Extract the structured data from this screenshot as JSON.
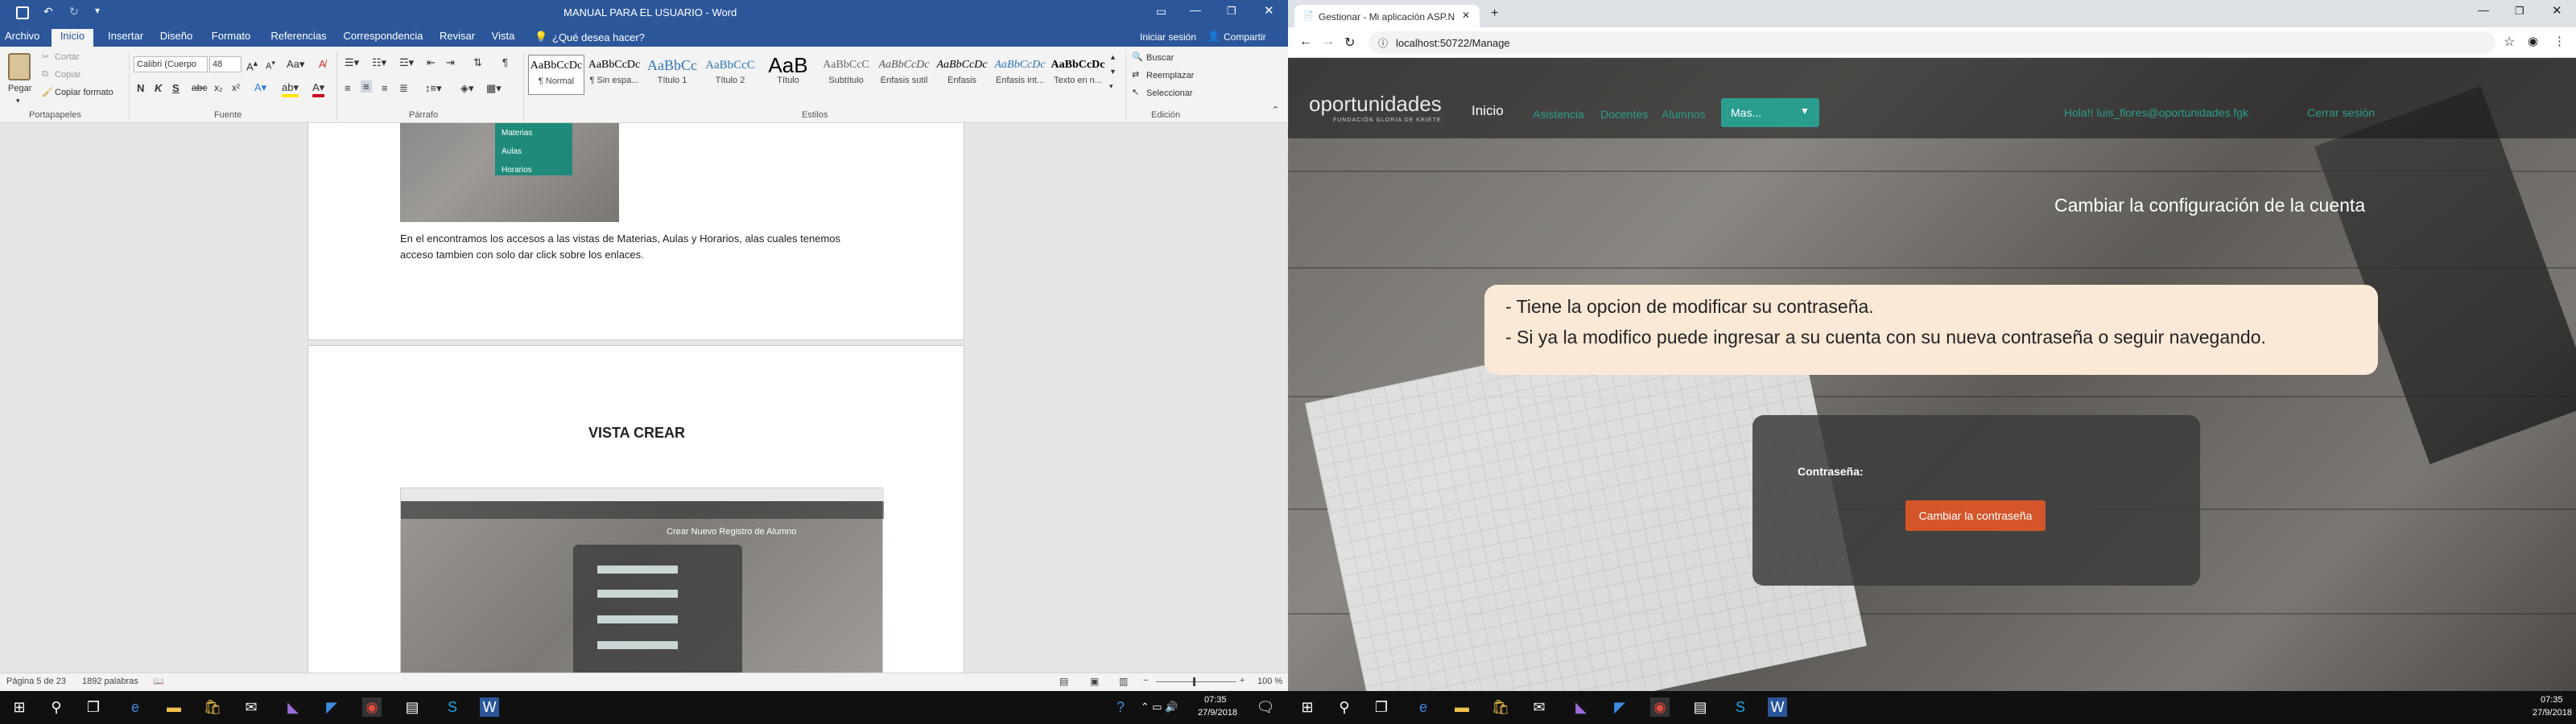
{
  "word": {
    "title": "MANUAL PARA EL USUARIO - Word",
    "quick_access": [
      "save-icon",
      "undo-icon",
      "redo-icon",
      "customize-icon"
    ],
    "ribbon_tabs": [
      "Archivo",
      "Inicio",
      "Insertar",
      "Diseño",
      "Formato",
      "Referencias",
      "Correspondencia",
      "Revisar",
      "Vista"
    ],
    "tell_me": "¿Qué desea hacer?",
    "sign_in": "Iniciar sesión",
    "share": "Compartir",
    "clipboard": {
      "paste": "Pegar",
      "cut": "Cortar",
      "copy": "Copiar",
      "format_painter": "Copiar formato",
      "group": "Portapapeles"
    },
    "font": {
      "name": "Calibri (Cuerpo",
      "size": "48",
      "group": "Fuente",
      "bold": "N",
      "italic": "K",
      "underline": "S"
    },
    "paragraph": {
      "group": "Párrafo"
    },
    "styles": {
      "group": "Estilos",
      "items": [
        {
          "sample": "AaBbCcDc",
          "name": "¶ Normal"
        },
        {
          "sample": "AaBbCcDc",
          "name": "¶ Sin espa..."
        },
        {
          "sample": "AaBbCc",
          "name": "Título 1"
        },
        {
          "sample": "AaBbCcC",
          "name": "Título 2"
        },
        {
          "sample": "AaB",
          "name": "Título"
        },
        {
          "sample": "AaBbCcC",
          "name": "Subtítulo"
        },
        {
          "sample": "AaBbCcDc",
          "name": "Énfasis sutil"
        },
        {
          "sample": "AaBbCcDc",
          "name": "Énfasis"
        },
        {
          "sample": "AaBbCcDc",
          "name": "Énfasis int..."
        },
        {
          "sample": "AaBbCcDc",
          "name": "Texto en n..."
        }
      ]
    },
    "editing": {
      "find": "Buscar",
      "replace": "Reemplazar",
      "select": "Seleccionar",
      "group": "Edición"
    },
    "doc": {
      "menu_items": [
        "Materias",
        "Aulas",
        "Horarios"
      ],
      "paragraph_line1": "En el encontramos los accesos a las vistas de Materias, Aulas y Horarios, alas cuales tenemos",
      "paragraph_line2": "acceso tambien con solo dar click sobre los enlaces.",
      "heading": "VISTA CREAR",
      "thumb_title": "Crear Nuevo Registro de Alumno"
    },
    "status": {
      "page": "Página 5 de 23",
      "words": "1892 palabras",
      "zoom": "100 %"
    }
  },
  "chrome": {
    "tab_title": "Gestionar - Mi aplicación ASP.NE",
    "url": "localhost:50722/Manage",
    "site": {
      "logo": "oportunidades",
      "logo_sub": "FUNDACIÓN GLORIA DE KRIETE",
      "nav": [
        "Inicio",
        "Asistencia",
        "Docentes",
        "Alumnos"
      ],
      "more": "Mas...",
      "greeting": "Hola!! luis_flores@oportunidades.fgk",
      "logout": "Cerrar sesión",
      "heading": "Cambiar la configuración de la cuenta",
      "note_line1": "- Tiene la opcion de modificar su contraseña.",
      "note_line2": "- Si ya la modifico puede ingresar a su cuenta con su nueva contraseña o seguir navegando.",
      "password_label": "Contraseña:",
      "change_button": "Cambiar la contraseña"
    }
  },
  "taskbar": {
    "left_time": "07:35",
    "left_date": "27/9/2018",
    "right_time": "07:35",
    "right_date": "27/9/2018"
  },
  "colors": {
    "word_blue": "#2b579a",
    "site_accent": "#2a9d8f",
    "button_orange": "#d4552a",
    "callout_bg": "#fbe9d7"
  }
}
